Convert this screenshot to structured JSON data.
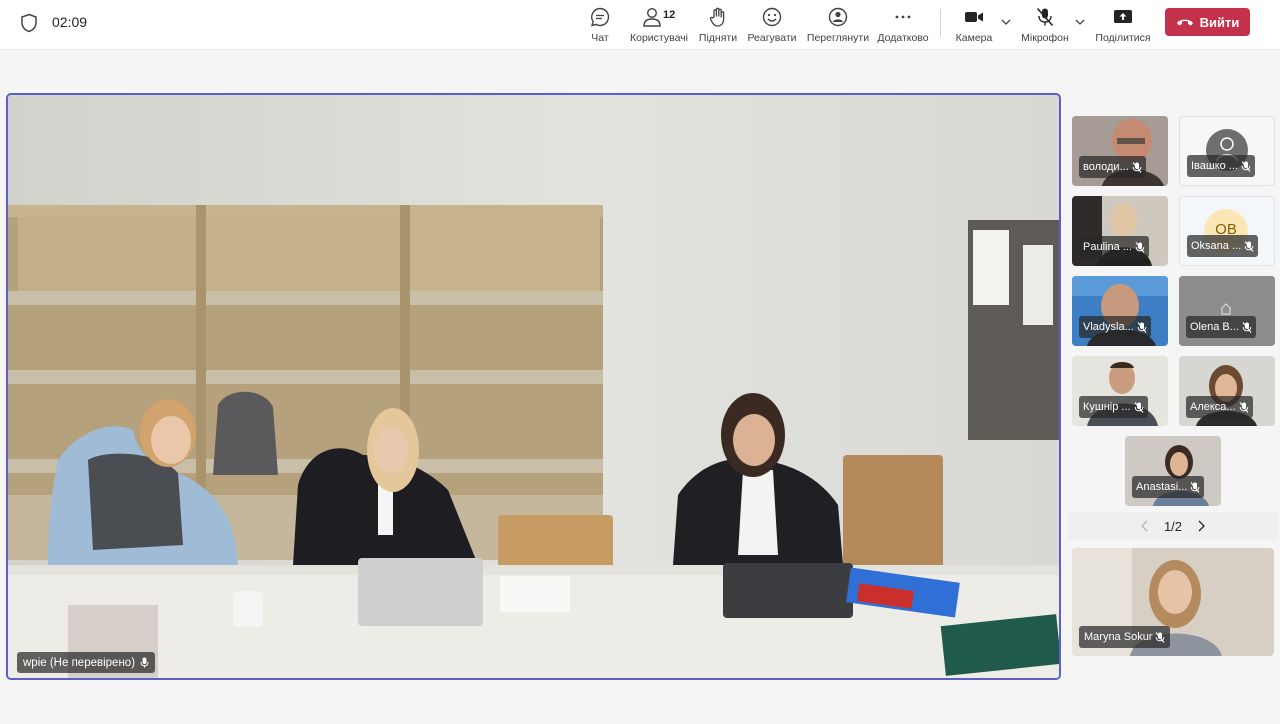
{
  "header": {
    "timer": "02:09",
    "participants_count": "12"
  },
  "toolbar": {
    "chat": "Чат",
    "people": "Користувачі",
    "raise": "Підняти",
    "react": "Реагувати",
    "view": "Переглянути",
    "more": "Додатково",
    "camera": "Камера",
    "mic": "Мікрофон",
    "share": "Поділитися",
    "leave": "Вийти"
  },
  "colors": {
    "accent": "#5b5fc7",
    "leave": "#c4314b"
  },
  "main": {
    "label": "wpie (Не перевірено)"
  },
  "participants": [
    {
      "name": "володи...",
      "muted": true,
      "type": "video"
    },
    {
      "name": "Івашко ...",
      "muted": true,
      "type": "avatar-icon"
    },
    {
      "name": "Paulina ...",
      "muted": true,
      "type": "video"
    },
    {
      "name": "Oksana ...",
      "muted": true,
      "type": "initials",
      "initials": "OB"
    },
    {
      "name": "Vladysla...",
      "muted": true,
      "type": "video"
    },
    {
      "name": "Olena B...",
      "muted": true,
      "type": "icon"
    },
    {
      "name": "Кушнір ...",
      "muted": true,
      "type": "video"
    },
    {
      "name": "Алекса...",
      "muted": true,
      "type": "video"
    },
    {
      "name": "Anastasi...",
      "muted": true,
      "type": "video"
    }
  ],
  "pager": {
    "text": "1/2"
  },
  "self": {
    "name": "Maryna Sokur"
  }
}
